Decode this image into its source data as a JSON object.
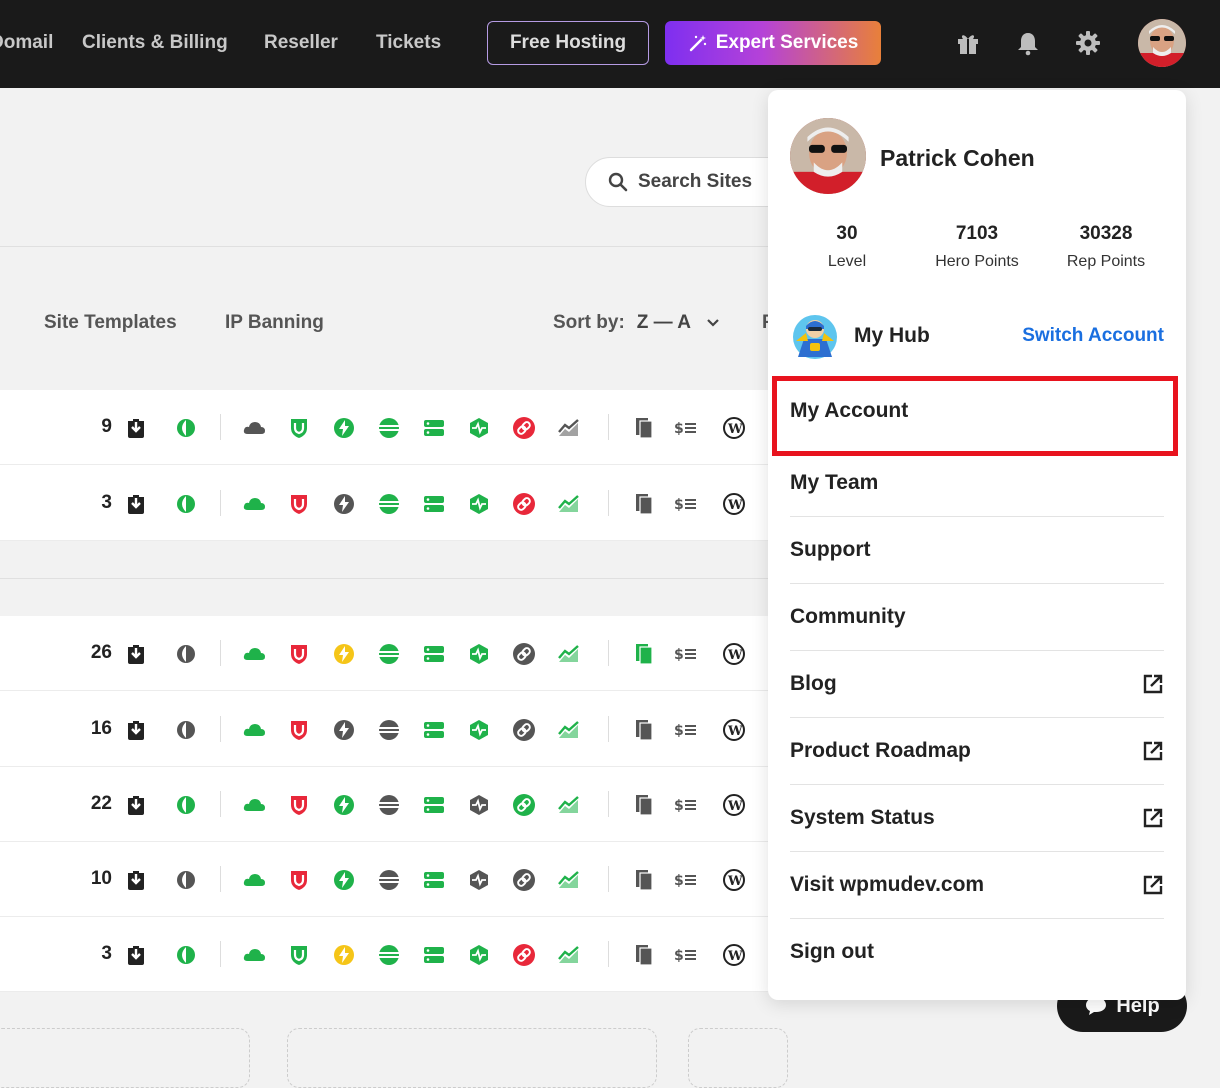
{
  "nav": {
    "links": [
      "Domail",
      "Clients & Billing",
      "Reseller",
      "Tickets"
    ],
    "free_hosting": "Free Hosting",
    "expert_services": "Expert Services"
  },
  "page": {
    "search_placeholder": "Search Sites",
    "tabs": [
      "Site Templates",
      "IP Banning"
    ],
    "sort_label": "Sort by:",
    "sort_value": "Z — A",
    "cut_letter": "F",
    "row_counts": [
      "9",
      "3",
      "26",
      "16",
      "22",
      "10",
      "3"
    ]
  },
  "profile": {
    "name": "Patrick Cohen",
    "stats": [
      {
        "value": "30",
        "label": "Level"
      },
      {
        "value": "7103",
        "label": "Hero Points"
      },
      {
        "value": "30328",
        "label": "Rep Points"
      }
    ],
    "hub_label": "My Hub",
    "switch_account": "Switch Account"
  },
  "menu": [
    {
      "label": "My Account",
      "external": false,
      "highlighted": true
    },
    {
      "label": "My Team",
      "external": false
    },
    {
      "label": "Support",
      "external": false
    },
    {
      "label": "Community",
      "external": false
    },
    {
      "label": "Blog",
      "external": true
    },
    {
      "label": "Product Roadmap",
      "external": true
    },
    {
      "label": "System Status",
      "external": true
    },
    {
      "label": "Visit wpmudev.com",
      "external": true
    },
    {
      "label": "Sign out",
      "external": false
    }
  ],
  "help": "Help",
  "colors": {
    "nav_bg": "#1a1a1a",
    "green": "#1fb24a",
    "red": "#e8283a",
    "yellow": "#f5c518",
    "gray_icon": "#555555",
    "link_blue": "#1a6fe0",
    "highlight_red": "#e8131e"
  }
}
